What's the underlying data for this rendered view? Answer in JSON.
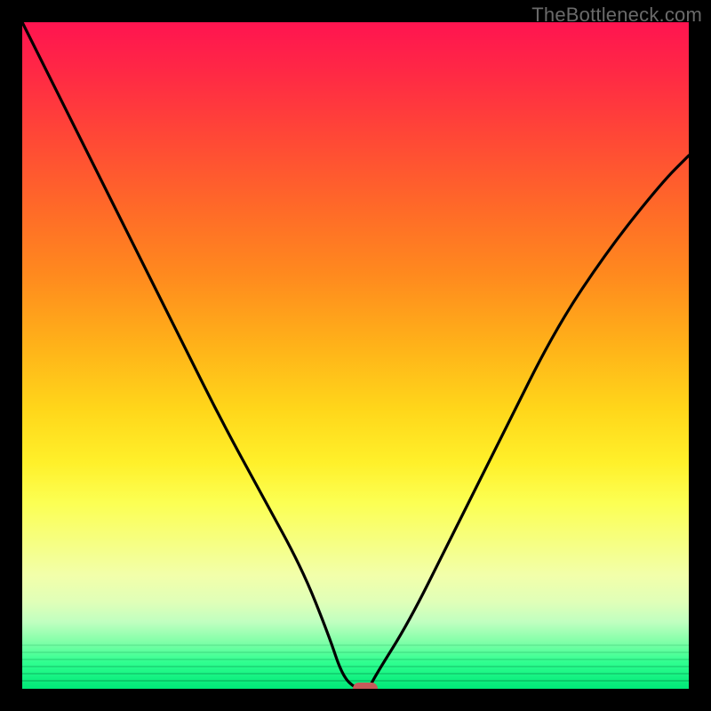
{
  "watermark": "TheBottleneck.com",
  "colors": {
    "background": "#000000",
    "curve": "#000000",
    "marker": "#c75a5a"
  },
  "chart_data": {
    "type": "line",
    "title": "",
    "xlabel": "",
    "ylabel": "",
    "xlim": [
      0,
      100
    ],
    "ylim": [
      0,
      100
    ],
    "series": [
      {
        "name": "curve",
        "x": [
          0,
          6,
          12,
          18,
          24,
          30,
          36,
          42,
          46,
          48,
          50,
          52,
          53,
          58,
          64,
          72,
          80,
          88,
          96,
          100
        ],
        "y": [
          100,
          88,
          76,
          64,
          52,
          40,
          29,
          18,
          8,
          2,
          0,
          0,
          2,
          10,
          22,
          38,
          54,
          66,
          76,
          80
        ]
      }
    ],
    "marker": {
      "x": 51.5,
      "y": 0
    },
    "gradient_stops": [
      {
        "pos": 0,
        "color": "#ff1450"
      },
      {
        "pos": 18,
        "color": "#ff4a35"
      },
      {
        "pos": 38,
        "color": "#ff8a1e"
      },
      {
        "pos": 58,
        "color": "#ffd61a"
      },
      {
        "pos": 72,
        "color": "#fcff52"
      },
      {
        "pos": 90,
        "color": "#c0ffc0"
      },
      {
        "pos": 100,
        "color": "#00e878"
      }
    ]
  }
}
